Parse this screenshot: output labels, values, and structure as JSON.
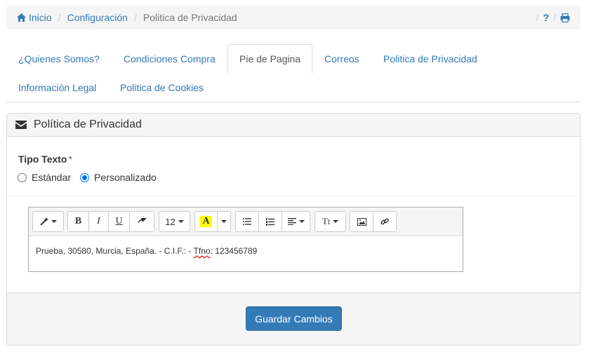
{
  "breadcrumb": {
    "items": [
      {
        "label": "Inicio",
        "icon": "home-icon"
      },
      {
        "label": "Configuración"
      },
      {
        "label": "Politica de Privacidad"
      }
    ],
    "right": {
      "sep": "/",
      "help": "?",
      "print_icon": "print-icon"
    }
  },
  "tabs": [
    {
      "label": "¿Quienes Somos?"
    },
    {
      "label": "Condiciones Compra"
    },
    {
      "label": "Pie de Pagina",
      "active": true
    },
    {
      "label": "Correos"
    },
    {
      "label": "Politica de Privacidad"
    },
    {
      "label": "Información Legal"
    },
    {
      "label": "Politica de Cookies"
    }
  ],
  "panel": {
    "title": "Política de Privacidad",
    "icon": "envelope-icon",
    "form": {
      "label": "Tipo Texto",
      "required_mark": "*",
      "options": [
        "Estándar",
        "Personalizado"
      ],
      "selected": "Personalizado"
    },
    "editor": {
      "toolbar": {
        "font_size": "12",
        "bold": "B",
        "italic": "I",
        "underline": "U",
        "color": "A",
        "height": "T",
        "height_suffix": "I"
      },
      "content_before": "Prueba, 30580, Murcia, España. - C.I.F.:  - ",
      "content_spell": "Tfno",
      "content_after": ": 123456789"
    },
    "save_label": "Guardar Cambios"
  },
  "colors": {
    "link": "#337ab7",
    "primary": "#337ab7",
    "highlight": "#ffff00",
    "required": "#a94442"
  }
}
